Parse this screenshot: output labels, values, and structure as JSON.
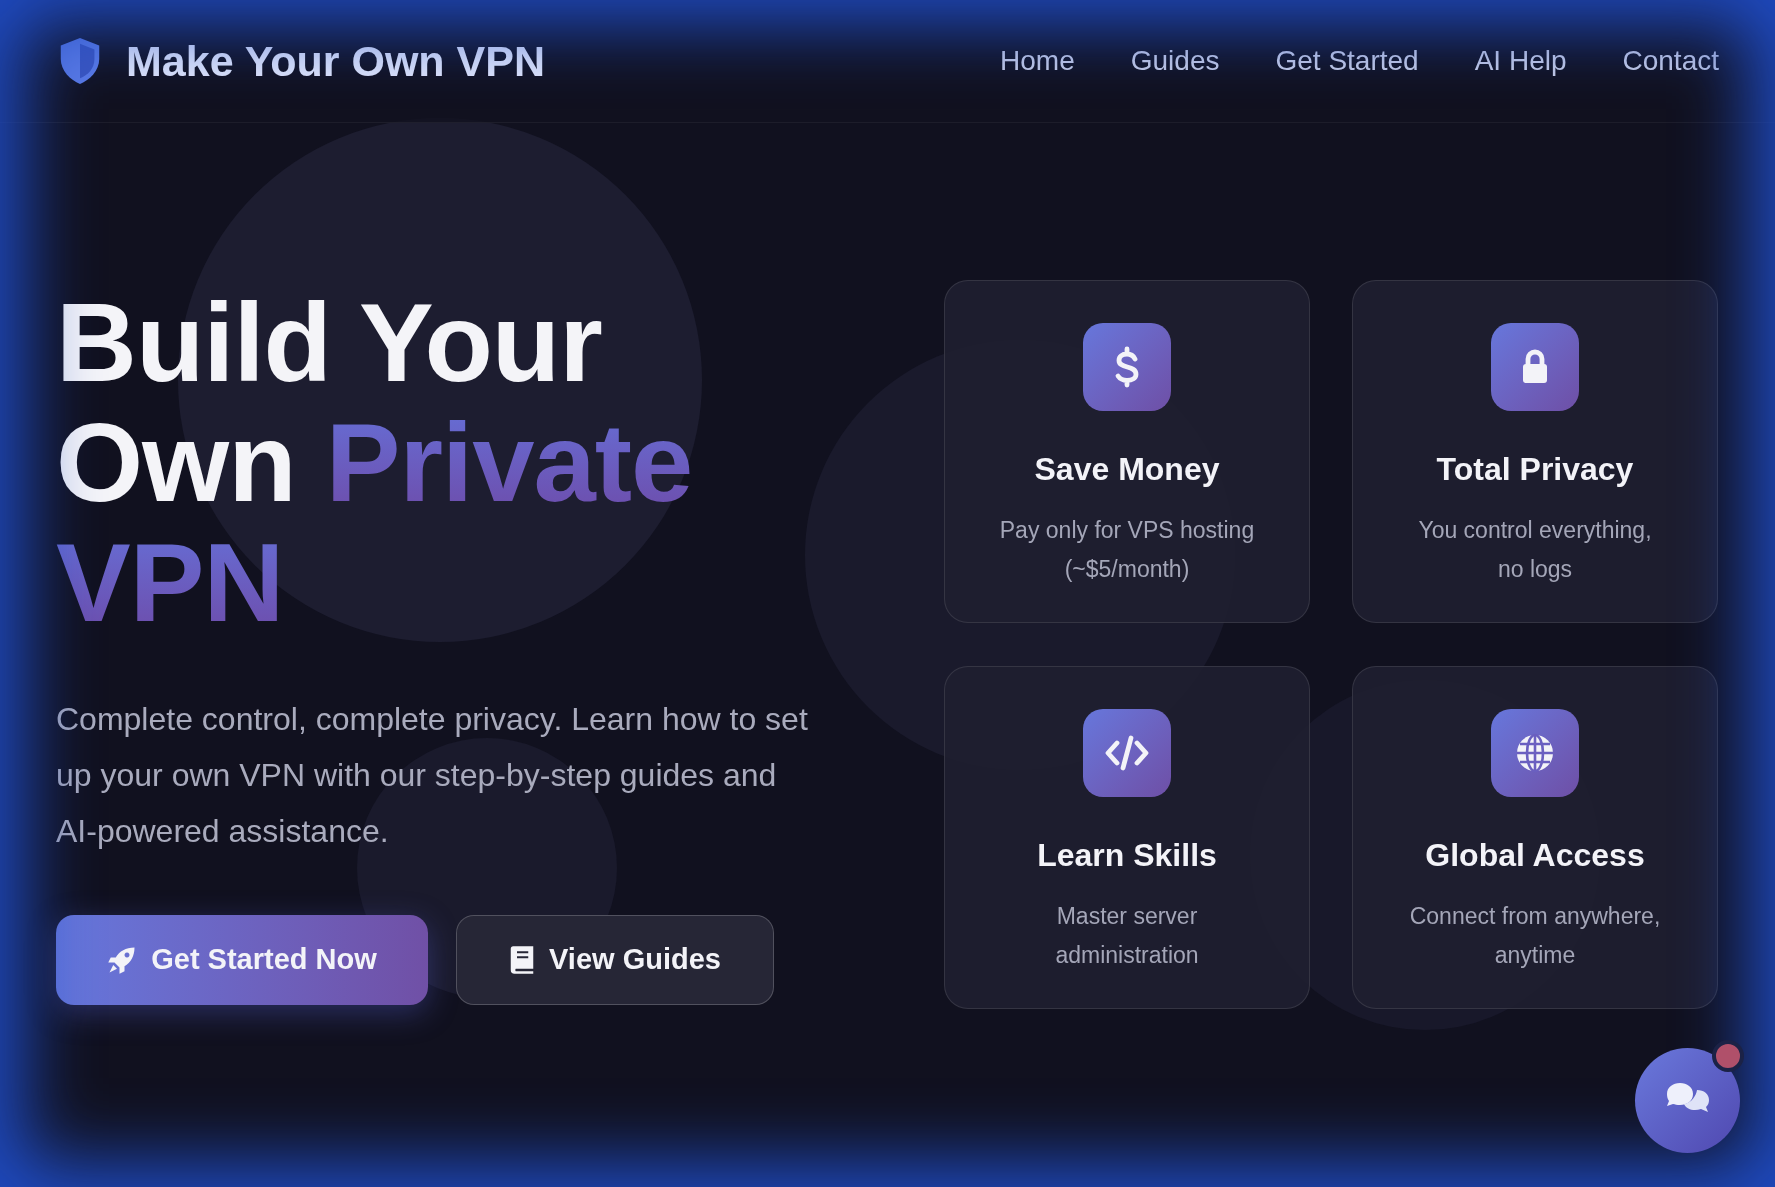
{
  "header": {
    "brand": "Make Your Own VPN",
    "nav": [
      "Home",
      "Guides",
      "Get Started",
      "AI Help",
      "Contact"
    ]
  },
  "hero": {
    "title": [
      {
        "text": "Build Your Own ",
        "highlight": false
      },
      {
        "text": "Private VPN",
        "highlight": true
      }
    ],
    "description": "Complete control, complete privacy. Learn how to set up your own VPN with our step-by-step guides and AI-powered assistance.",
    "buttons": [
      {
        "label": "Get Started Now",
        "kind": "primary"
      },
      {
        "label": "View Guides",
        "kind": "secondary"
      }
    ]
  },
  "features": [
    {
      "kind": "dollar",
      "title": "Save Money",
      "text": "Pay only for VPS hosting (~$5/month)"
    },
    {
      "kind": "lock",
      "title": "Total Privacy",
      "text": "You control everything, no logs"
    },
    {
      "kind": "code",
      "title": "Learn Skills",
      "text": "Master server administration"
    },
    {
      "kind": "globe",
      "title": "Global Access",
      "text": "Connect from anywhere, anytime"
    }
  ],
  "chat": {
    "notification": true
  }
}
